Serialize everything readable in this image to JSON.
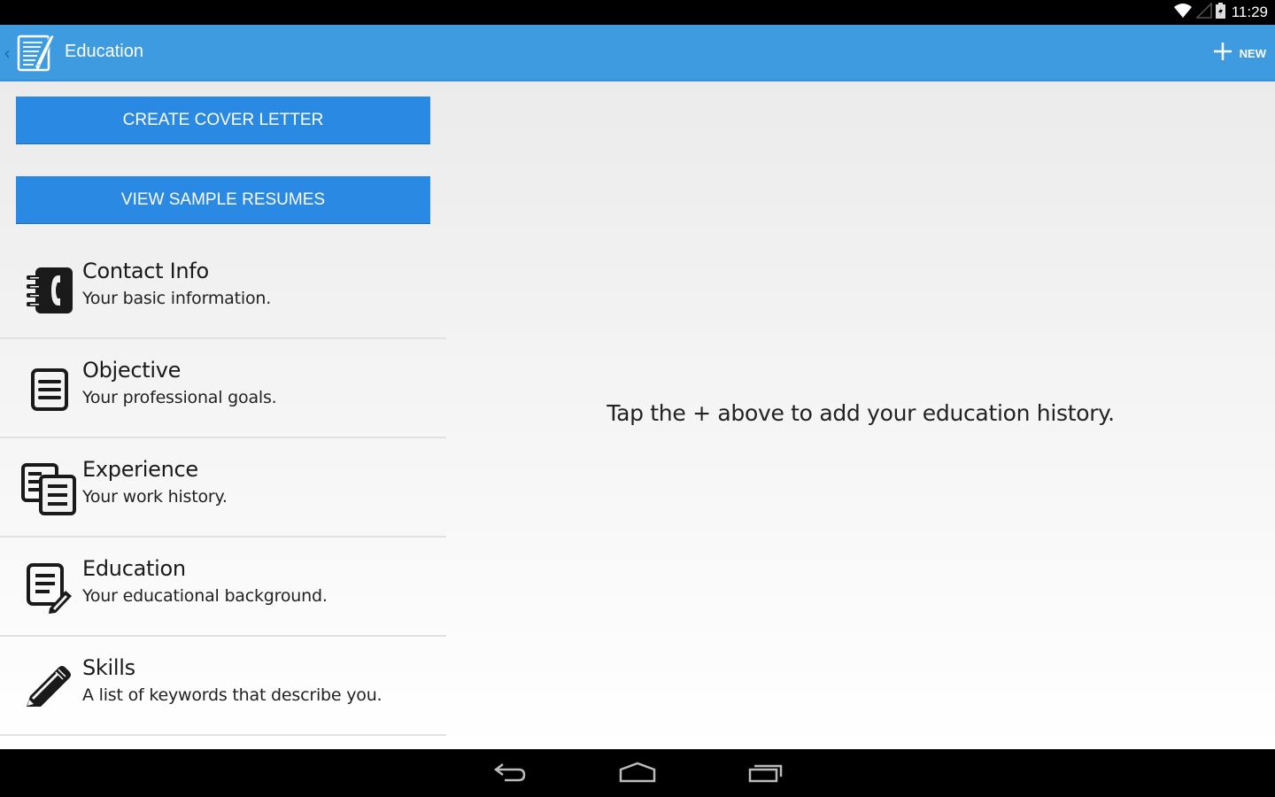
{
  "status_bar": {
    "time": "11:29",
    "icons": [
      "wifi-icon",
      "signal-icon",
      "battery-charging-icon"
    ]
  },
  "action_bar": {
    "title": "Education",
    "up_icon": "chevron-left-icon",
    "app_icon": "resume-notepad-icon",
    "new_button": {
      "icon": "plus-icon",
      "label": "NEW"
    },
    "background_color": "#3e9be0"
  },
  "left_pane": {
    "buttons": {
      "create_cover_letter": "CREATE COVER LETTER",
      "view_sample_resumes": "VIEW SAMPLE RESUMES",
      "color": "#2a89e2"
    },
    "sections": [
      {
        "title": "Contact Info",
        "subtitle": "Your basic information.",
        "icon": "contact-book-icon"
      },
      {
        "title": "Objective",
        "subtitle": "Your professional goals.",
        "icon": "document-icon"
      },
      {
        "title": "Experience",
        "subtitle": "Your work history.",
        "icon": "documents-stack-icon"
      },
      {
        "title": "Education",
        "subtitle": "Your educational background.",
        "icon": "document-edit-icon"
      },
      {
        "title": "Skills",
        "subtitle": "A list of keywords that describe you.",
        "icon": "pencil-icon"
      }
    ]
  },
  "right_pane": {
    "empty_message": "Tap the + above to add your education history."
  },
  "nav_bar": {
    "buttons": [
      "back-icon",
      "home-icon",
      "recent-apps-icon"
    ]
  }
}
